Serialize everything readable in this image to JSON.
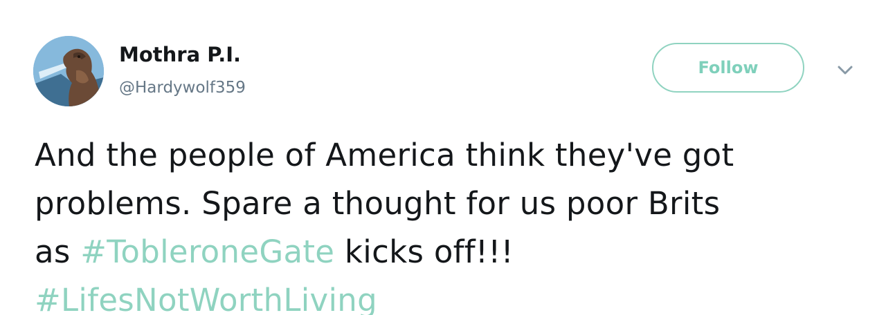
{
  "author": {
    "display_name": "Mothra P.I.",
    "handle": "@Hardywolf359",
    "avatar_icon": "godzilla-avatar"
  },
  "actions": {
    "follow_label": "Follow",
    "menu_icon": "chevron-down-icon"
  },
  "tweet": {
    "line1": "And the people of America think they've got",
    "line2": "problems. Spare a thought for us poor Brits",
    "line3_prefix": "as ",
    "hashtag1": "#TobleroneGate",
    "line3_suffix": " kicks off!!!",
    "hashtag2": "#LifesNotWorthLiving"
  },
  "colors": {
    "accent": "#8fd3c0",
    "text": "#14171a",
    "muted": "#657786"
  }
}
